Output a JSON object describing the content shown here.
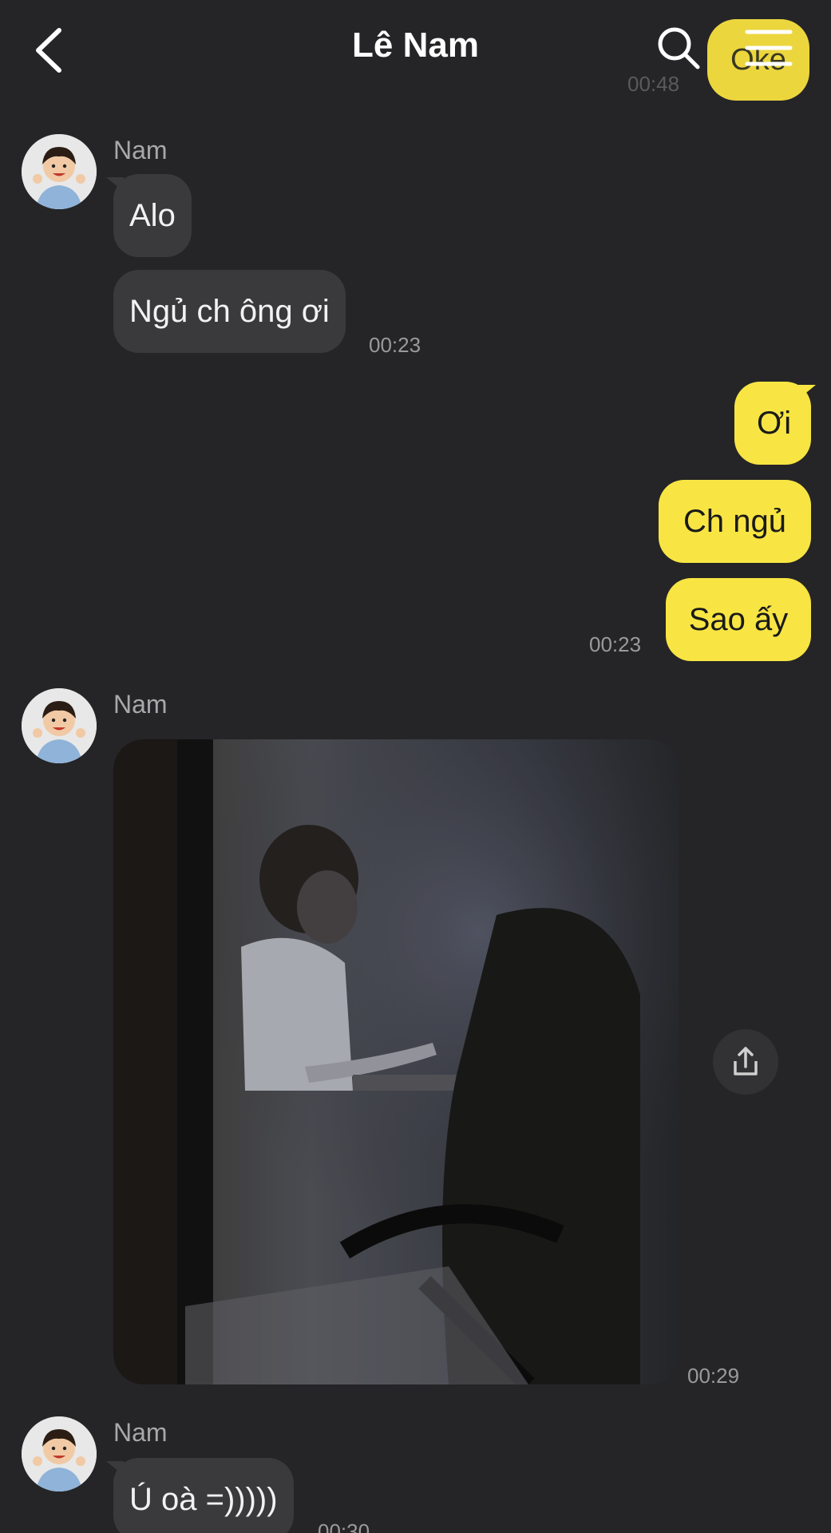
{
  "header": {
    "title": "Lê Nam",
    "back_icon": "chevron-left-icon",
    "search_icon": "search-icon",
    "menu_icon": "hamburger-menu-icon"
  },
  "ghost_message": {
    "text": "Oke",
    "time": "00:48"
  },
  "colors": {
    "background": "#252527",
    "incoming_bubble": "#3a3a3c",
    "outgoing_bubble": "#f8e543",
    "timestamp": "#9a9a9d"
  },
  "messages": [
    {
      "sender": "Nam",
      "bubbles": [
        "Alo",
        "Ngủ ch ông ơi"
      ],
      "time": "00:23"
    },
    {
      "sender": "me",
      "bubbles": [
        "Ơi",
        "Ch ngủ",
        "Sao ấy"
      ],
      "time": "00:23"
    },
    {
      "sender": "Nam",
      "type": "photo",
      "time": "00:29",
      "share_icon": "share-upload-icon"
    },
    {
      "sender": "Nam",
      "bubbles": [
        "Ú oà =)))))"
      ],
      "time": "00:30"
    }
  ]
}
